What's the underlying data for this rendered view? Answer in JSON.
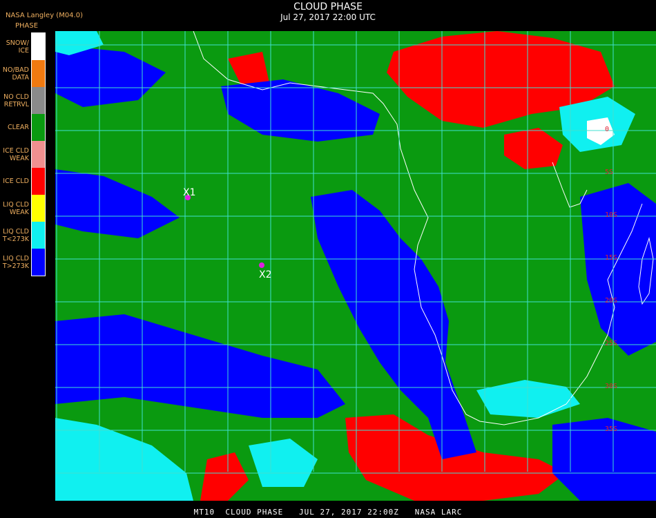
{
  "header": {
    "source": "NASA Langley (M04.0)",
    "title": "CLOUD PHASE",
    "datetime": "Jul 27, 2017 22:00 UTC"
  },
  "legend": {
    "title": "PHASE",
    "items": [
      {
        "label": "SNOW/\nICE",
        "color": "#ffffff"
      },
      {
        "label": "NO/BAD\nDATA",
        "color": "#f07a10"
      },
      {
        "label": "NO CLD\nRETRVL",
        "color": "#8a8a8a"
      },
      {
        "label": "CLEAR",
        "color": "#0a9a10"
      },
      {
        "label": "ICE CLD\nWEAK",
        "color": "#f09090"
      },
      {
        "label": "ICE CLD",
        "color": "#ff0000"
      },
      {
        "label": "LIQ CLD\nWEAK",
        "color": "#ffff00"
      },
      {
        "label": "LIQ CLD\nT<273K",
        "color": "#10f0f0"
      },
      {
        "label": "LIQ CLD\nT>273K",
        "color": "#0000ff"
      }
    ]
  },
  "map": {
    "markers": [
      {
        "label": "X1",
        "color": "#e020e0"
      },
      {
        "label": "X2",
        "color": "#e020e0"
      }
    ],
    "lat_labels": [
      "0",
      "5S",
      "10S",
      "15S",
      "20S",
      "25S",
      "30S",
      "35S"
    ],
    "grid_color": "#40e0d0"
  },
  "footer": {
    "text": "MT10  CLOUD PHASE   JUL 27, 2017 22:00Z   NASA LARC"
  }
}
